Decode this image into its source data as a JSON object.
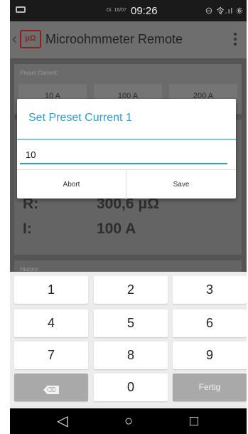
{
  "status_bar": {
    "date": "Di. 16/07",
    "time": "09:26",
    "indicators": "⊖ 令.ıl ⑥"
  },
  "app_bar": {
    "back_glyph": "‹",
    "logo_text": "μΩ",
    "title": "Microohmmeter Remote"
  },
  "background": {
    "preset_label": "Preset Current:",
    "presets": [
      "10 A",
      "100 A",
      "200 A"
    ],
    "resistance_label": "R:",
    "resistance_value": "300,6 μΩ",
    "current_label": "I:",
    "current_value": "100 A",
    "history_label": "History:"
  },
  "dialog": {
    "title": "Set Preset Current 1",
    "input_value": "10",
    "abort_label": "Abort",
    "save_label": "Save",
    "accent_color": "#2a9fd6"
  },
  "keyboard": {
    "keys": [
      "1",
      "2",
      "3",
      "4",
      "5",
      "6",
      "7",
      "8",
      "9",
      "⌫",
      "0",
      "Fertig"
    ]
  },
  "nav_bar": {
    "back_glyph": "◁",
    "home_glyph": "○",
    "recents_glyph": "□"
  }
}
